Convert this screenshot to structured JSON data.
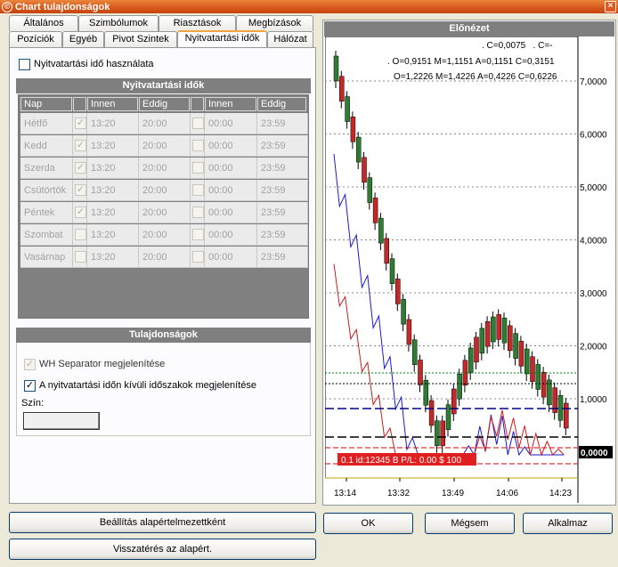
{
  "window": {
    "title": "Chart tulajdonságok",
    "close_glyph": "×"
  },
  "tabs_row1": [
    "Általános",
    "Szimbólumok",
    "Riasztások",
    "Megbízások"
  ],
  "tabs_row2": [
    "Pozíciók",
    "Egyéb",
    "Pivot Szintek",
    "Nyitvatartási idők",
    "Hálózat"
  ],
  "active_tab": "Nyitvatartási idők",
  "use_hours": {
    "label": "Nyitvatartási idő használata",
    "checked": false
  },
  "hours_table": {
    "title": "Nyitvatartási idők",
    "headers": [
      "Nap",
      "",
      "Innen",
      "Eddig",
      "",
      "Innen",
      "Eddig"
    ],
    "rows": [
      {
        "day": "Hétfő",
        "c1": true,
        "from1": "13:20",
        "to1": "20:00",
        "c2": false,
        "from2": "00:00",
        "to2": "23:59"
      },
      {
        "day": "Kedd",
        "c1": true,
        "from1": "13:20",
        "to1": "20:00",
        "c2": false,
        "from2": "00:00",
        "to2": "23:59"
      },
      {
        "day": "Szerda",
        "c1": true,
        "from1": "13:20",
        "to1": "20:00",
        "c2": false,
        "from2": "00:00",
        "to2": "23:59"
      },
      {
        "day": "Csütörtök",
        "c1": true,
        "from1": "13:20",
        "to1": "20:00",
        "c2": false,
        "from2": "00:00",
        "to2": "23:59"
      },
      {
        "day": "Péntek",
        "c1": true,
        "from1": "13:20",
        "to1": "20:00",
        "c2": false,
        "from2": "00:00",
        "to2": "23:59"
      },
      {
        "day": "Szombat",
        "c1": false,
        "from1": "13:20",
        "to1": "20:00",
        "c2": false,
        "from2": "00:00",
        "to2": "23:59"
      },
      {
        "day": "Vasárnap",
        "c1": false,
        "from1": "13:20",
        "to1": "20:00",
        "c2": false,
        "from2": "00:00",
        "to2": "23:59"
      }
    ]
  },
  "properties": {
    "title": "Tulajdonságok",
    "wh_separator": {
      "label": "WH Separator megjelenítése",
      "checked": true,
      "disabled": true
    },
    "show_outside": {
      "label": "A nyitvatartási időn kívüli időszakok megjelenítése",
      "checked": true
    },
    "color_label": "Szín:"
  },
  "buttons": {
    "set_default": "Beállítás alapértelmezettként",
    "revert_default": "Visszatérés az alapért.",
    "ok": "OK",
    "cancel": "Mégsem",
    "apply": "Alkalmaz"
  },
  "preview": {
    "title": "Előnézet",
    "ohlc_line1": ". C=0,0075   . C=-",
    "ohlc_line2": ". O=0,9151 M=1,1151 A=0,1151 C=0,3151",
    "ohlc_line3": "O=1,2226 M=1,4226 A=0,4226 C=0,6226",
    "y_labels": [
      "7,0000",
      "6,0000",
      "5,0000",
      "4,0000",
      "3,0000",
      "2,0000",
      "1,0000"
    ],
    "current_price": "0,0000",
    "x_labels": [
      "13:14",
      "13:32",
      "13:49",
      "14:06",
      "14:23"
    ],
    "order_label": "0.1 id:12345 B P/L: 0.00 $ 100"
  },
  "colors": {
    "bull": "#2e7d32",
    "bear": "#c62828",
    "accent": "#f7a33d",
    "titlebar": "#d7561b"
  }
}
